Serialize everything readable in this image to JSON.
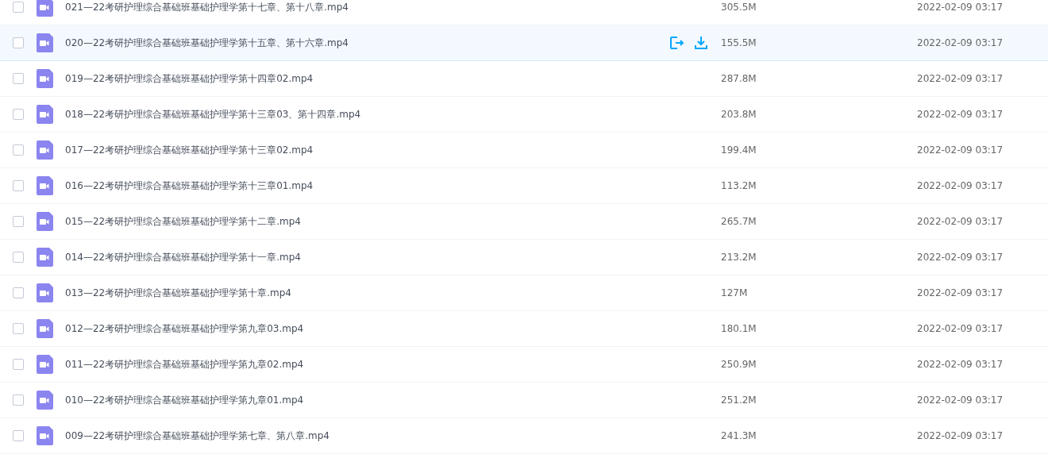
{
  "files": [
    {
      "name": "021—22考研护理综合基础班基础护理学第十七章、第十八章.mp4",
      "size": "305.5M",
      "date": "2022-02-09 03:17",
      "checked": false,
      "hovered": false
    },
    {
      "name": "020—22考研护理综合基础班基础护理学第十五章、第十六章.mp4",
      "size": "155.5M",
      "date": "2022-02-09 03:17",
      "checked": false,
      "hovered": true
    },
    {
      "name": "019—22考研护理综合基础班基础护理学第十四章02.mp4",
      "size": "287.8M",
      "date": "2022-02-09 03:17",
      "checked": false,
      "hovered": false
    },
    {
      "name": "018—22考研护理综合基础班基础护理学第十三章03、第十四章.mp4",
      "size": "203.8M",
      "date": "2022-02-09 03:17",
      "checked": false,
      "hovered": false
    },
    {
      "name": "017—22考研护理综合基础班基础护理学第十三章02.mp4",
      "size": "199.4M",
      "date": "2022-02-09 03:17",
      "checked": false,
      "hovered": false
    },
    {
      "name": "016—22考研护理综合基础班基础护理学第十三章01.mp4",
      "size": "113.2M",
      "date": "2022-02-09 03:17",
      "checked": false,
      "hovered": false
    },
    {
      "name": "015—22考研护理综合基础班基础护理学第十二章.mp4",
      "size": "265.7M",
      "date": "2022-02-09 03:17",
      "checked": false,
      "hovered": false
    },
    {
      "name": "014—22考研护理综合基础班基础护理学第十一章.mp4",
      "size": "213.2M",
      "date": "2022-02-09 03:17",
      "checked": false,
      "hovered": false
    },
    {
      "name": "013—22考研护理综合基础班基础护理学第十章.mp4",
      "size": "127M",
      "date": "2022-02-09 03:17",
      "checked": false,
      "hovered": false
    },
    {
      "name": "012—22考研护理综合基础班基础护理学第九章03.mp4",
      "size": "180.1M",
      "date": "2022-02-09 03:17",
      "checked": false,
      "hovered": false
    },
    {
      "name": "011—22考研护理综合基础班基础护理学第九章02.mp4",
      "size": "250.9M",
      "date": "2022-02-09 03:17",
      "checked": false,
      "hovered": false
    },
    {
      "name": "010—22考研护理综合基础班基础护理学第九章01.mp4",
      "size": "251.2M",
      "date": "2022-02-09 03:17",
      "checked": false,
      "hovered": false
    },
    {
      "name": "009—22考研护理综合基础班基础护理学第七章、第八章.mp4",
      "size": "241.3M",
      "date": "2022-02-09 03:17",
      "checked": false,
      "hovered": false
    }
  ]
}
